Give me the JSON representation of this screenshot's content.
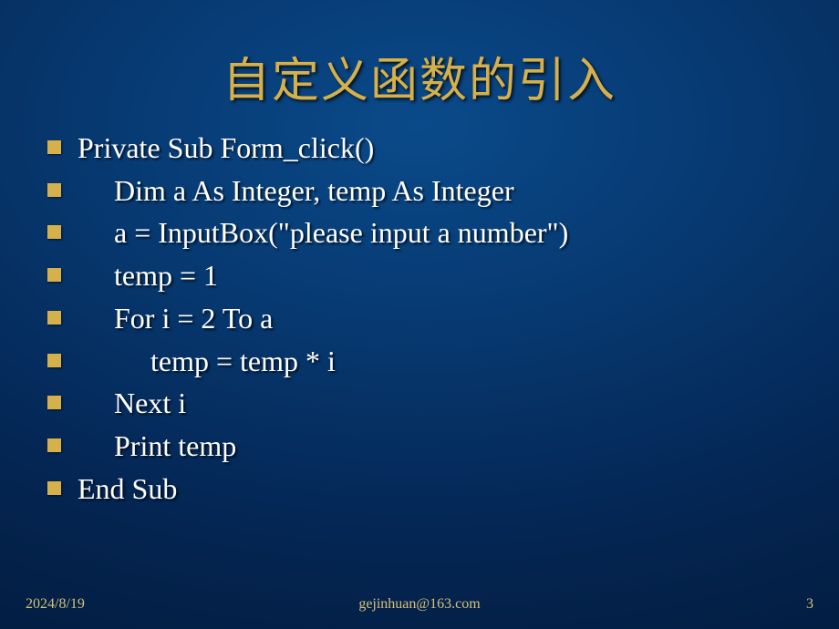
{
  "title": "自定义函数的引入",
  "lines": [
    "Private Sub Form_click()",
    "     Dim a As Integer, temp As Integer",
    "     a = InputBox(\"please input a number\")",
    "     temp = 1",
    "     For i = 2 To a",
    "          temp = temp * i",
    "     Next i",
    "     Print temp",
    "End Sub"
  ],
  "footer": {
    "date": "2024/8/19",
    "email": "gejinhuan@163.com",
    "page": "3"
  }
}
